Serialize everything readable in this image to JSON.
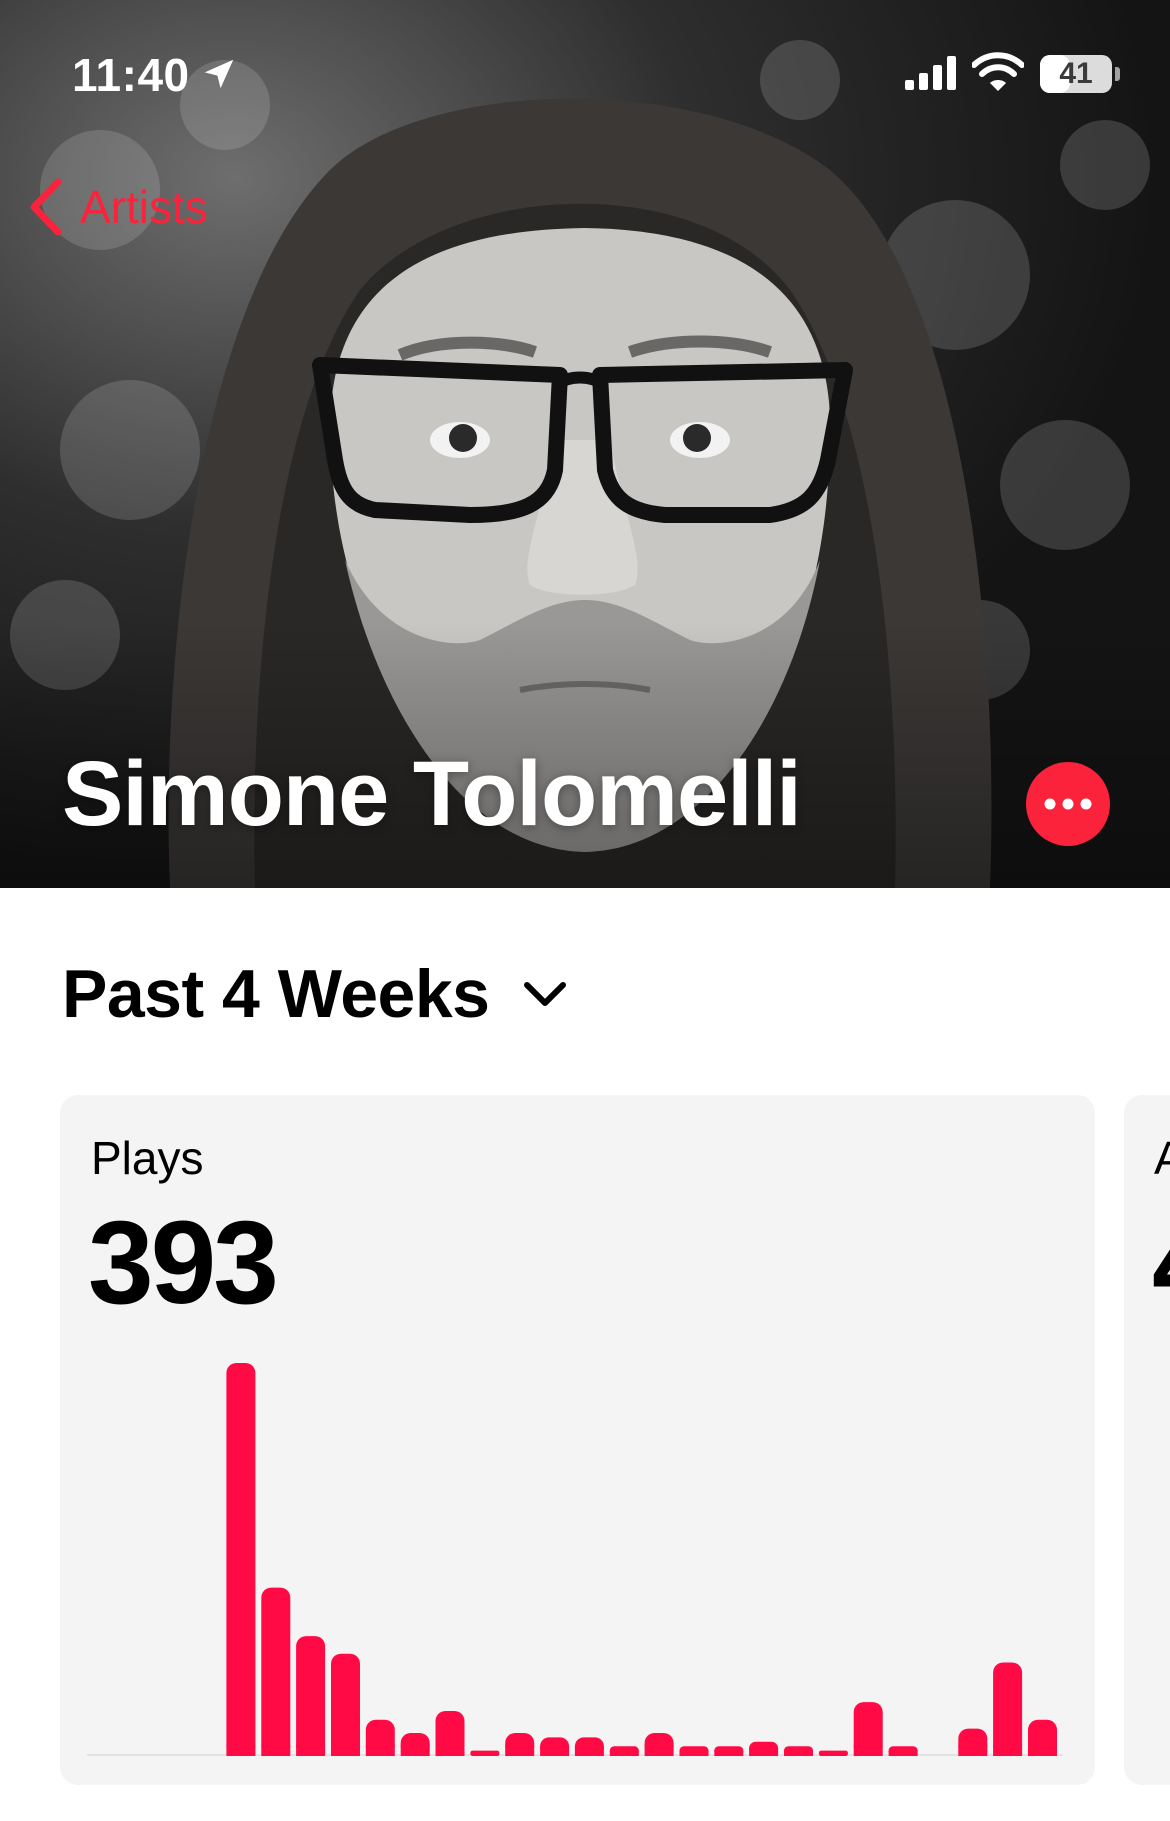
{
  "status_bar": {
    "time": "11:40",
    "battery_percent": "41",
    "battery_level": 0.41,
    "icons": [
      "location-arrow-icon",
      "cellular-signal-icon",
      "wifi-icon",
      "battery-icon"
    ]
  },
  "nav": {
    "back_label": "Artists",
    "back_icon": "chevron-left-icon"
  },
  "artist": {
    "name": "Simone Tolomelli",
    "more_icon": "ellipsis-icon"
  },
  "period": {
    "label": "Past 4 Weeks",
    "icon": "chevron-down-icon"
  },
  "stats": {
    "plays_label": "Plays",
    "plays_value": "393",
    "next_card_label": "A",
    "next_card_value": "4"
  },
  "colors": {
    "accent": "#fa233b",
    "bar": "#ff0a45",
    "card_bg": "#f4f4f4",
    "text": "#000000"
  },
  "chart_data": {
    "type": "bar",
    "series": [
      {
        "values": [
          0,
          0,
          0,
          0,
          89,
          38,
          27,
          23,
          8,
          5,
          10,
          1,
          5,
          4,
          4,
          2,
          5,
          2,
          2,
          3,
          2,
          1,
          12,
          2,
          0,
          6,
          21,
          8
        ]
      }
    ]
  }
}
